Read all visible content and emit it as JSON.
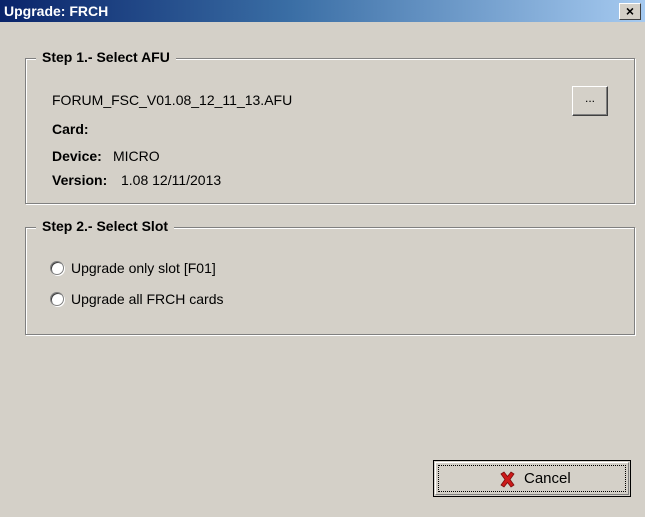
{
  "window": {
    "title": "Upgrade: FRCH",
    "close_glyph": "✕"
  },
  "step1": {
    "legend": "Step 1.- Select AFU",
    "filename": "FORUM_FSC_V01.08_12_11_13.AFU",
    "browse_label": "...",
    "card_label": "Card:",
    "card_value": "",
    "device_label": "Device:",
    "device_value": "MICRO",
    "version_label": "Version:",
    "version_value": "1.08 12/11/2013"
  },
  "step2": {
    "legend": "Step 2.- Select Slot",
    "options": [
      {
        "label": "Upgrade only slot [F01]",
        "selected": false
      },
      {
        "label": "Upgrade all FRCH cards",
        "selected": false
      }
    ]
  },
  "footer": {
    "cancel_label": "Cancel",
    "cancel_icon": "red-x-icon",
    "cancel_icon_color": "#cc1a1a"
  },
  "colors": {
    "dialog_bg": "#d4d0c8",
    "title_start": "#0a246a",
    "title_end": "#a6caf0"
  }
}
